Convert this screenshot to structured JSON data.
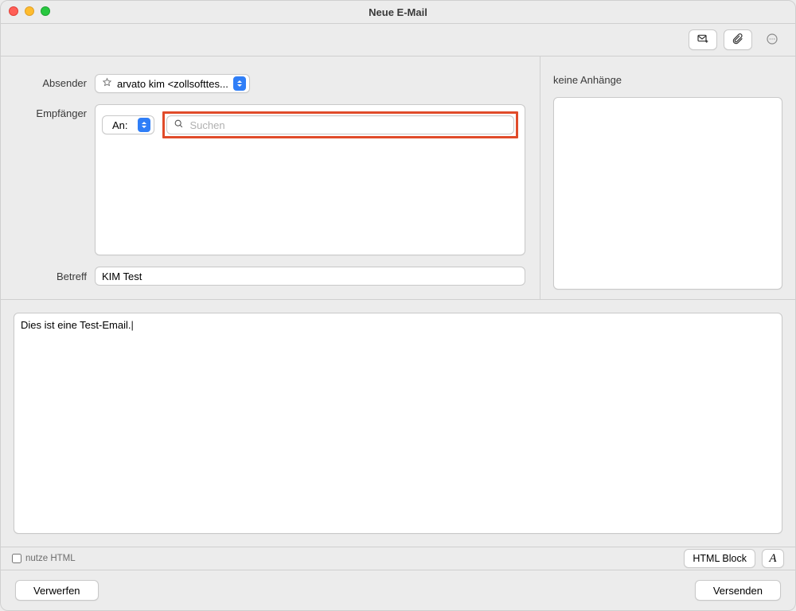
{
  "window": {
    "title": "Neue E-Mail"
  },
  "toolbar": {
    "envelope_icon": "envelope-add-icon",
    "attach_icon": "paperclip-icon",
    "more_icon": "more-icon"
  },
  "labels": {
    "sender": "Absender",
    "recipients": "Empfänger",
    "subject": "Betreff"
  },
  "sender": {
    "selected": "arvato kim <zollsofttes..."
  },
  "recipient": {
    "type_selected": "An:",
    "search_placeholder": "Suchen",
    "search_value": ""
  },
  "subject": {
    "value": "KIM Test"
  },
  "attachments": {
    "title": "keine Anhänge"
  },
  "body": {
    "text": "Dies ist eine Test-Email."
  },
  "options": {
    "use_html_label": "nutze HTML",
    "use_html_checked": false,
    "html_block_label": "HTML Block"
  },
  "footer": {
    "discard_label": "Verwerfen",
    "send_label": "Versenden"
  }
}
